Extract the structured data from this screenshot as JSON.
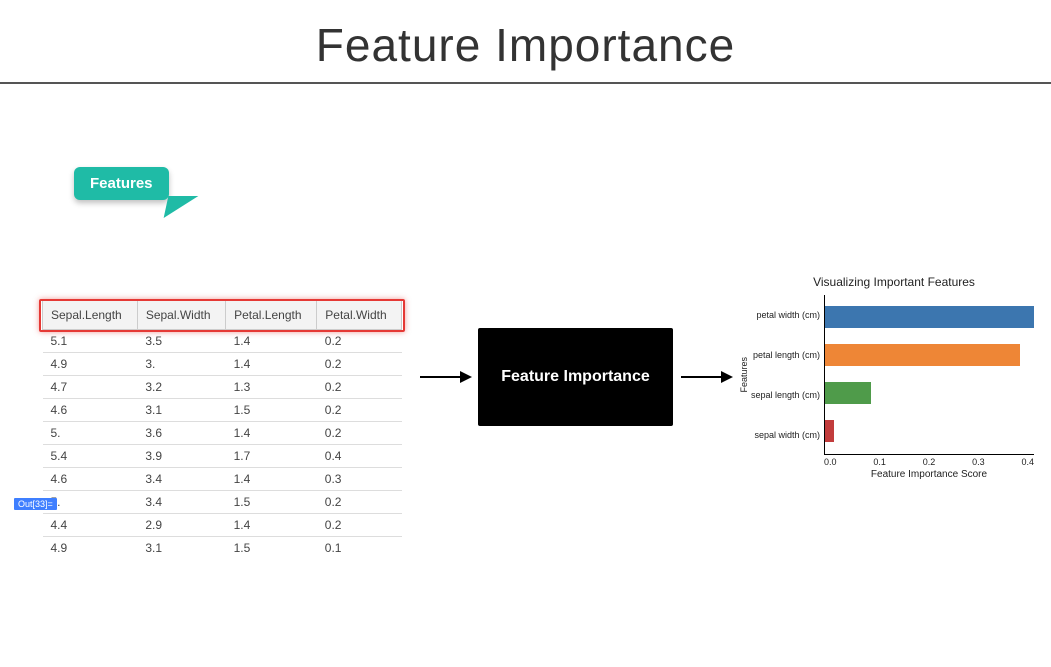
{
  "title": "Feature Importance",
  "callout": "Features",
  "out_label": "Out[33]=",
  "table": {
    "headers": [
      "Sepal.Length",
      "Sepal.Width",
      "Petal.Length",
      "Petal.Width"
    ],
    "rows": [
      [
        "5.1",
        "3.5",
        "1.4",
        "0.2"
      ],
      [
        "4.9",
        "3.",
        "1.4",
        "0.2"
      ],
      [
        "4.7",
        "3.2",
        "1.3",
        "0.2"
      ],
      [
        "4.6",
        "3.1",
        "1.5",
        "0.2"
      ],
      [
        "5.",
        "3.6",
        "1.4",
        "0.2"
      ],
      [
        "5.4",
        "3.9",
        "1.7",
        "0.4"
      ],
      [
        "4.6",
        "3.4",
        "1.4",
        "0.3"
      ],
      [
        "5.",
        "3.4",
        "1.5",
        "0.2"
      ],
      [
        "4.4",
        "2.9",
        "1.4",
        "0.2"
      ],
      [
        "4.9",
        "3.1",
        "1.5",
        "0.1"
      ]
    ]
  },
  "box_label": "Feature Importance",
  "chart_data": {
    "type": "bar",
    "orientation": "horizontal",
    "title": "Visualizing Important Features",
    "xlabel": "Feature Importance Score",
    "ylabel": "Features",
    "xlim": [
      0.0,
      0.45
    ],
    "xticks": [
      "0.0",
      "0.1",
      "0.2",
      "0.3",
      "0.4"
    ],
    "series": [
      {
        "name": "petal width (cm)",
        "value": 0.45,
        "color": "#3c76af"
      },
      {
        "name": "petal length (cm)",
        "value": 0.42,
        "color": "#ee8636"
      },
      {
        "name": "sepal length (cm)",
        "value": 0.1,
        "color": "#4f9b4a"
      },
      {
        "name": "sepal width (cm)",
        "value": 0.02,
        "color": "#c23c3c"
      }
    ]
  }
}
